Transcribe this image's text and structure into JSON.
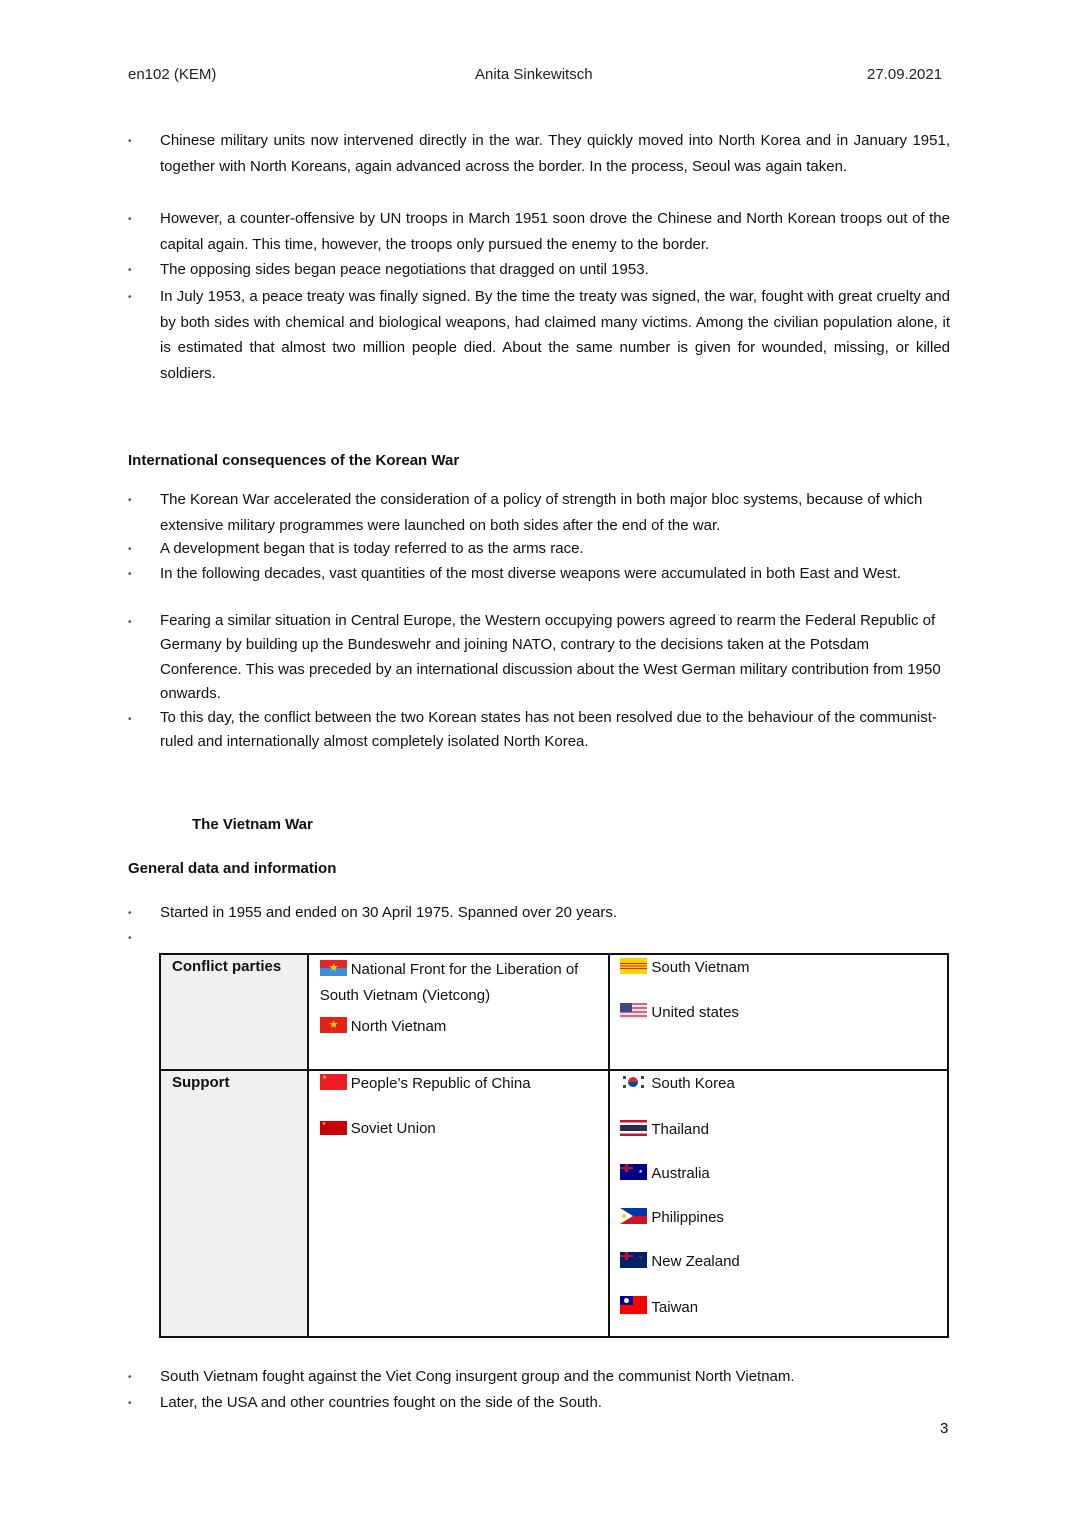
{
  "header": {
    "course": "en102 (KEM)",
    "author": "Anita Sinkewitsch",
    "date": "27.09.2021"
  },
  "korean_war_continued": {
    "bullets": [
      "Chinese military units now intervened directly in the war. They quickly moved into North Korea and in January 1951, together with North Koreans, again advanced across the border. In the process, Seoul was again taken.",
      "However, a counter-offensive by UN troops in March 1951 soon drove the Chinese and North Korean troops out of the capital again. This time, however, the troops only pursued the enemy to the border.",
      "The opposing sides began peace negotiations that dragged on until 1953.",
      "In July 1953, a peace treaty was finally signed. By the time the treaty was signed, the war, fought with great cruelty and by both sides with chemical and biological weapons, had claimed many victims. Among the civilian population alone, it is estimated that almost two million people died. About the same number is given for wounded, missing, or killed soldiers."
    ]
  },
  "international_consequences": {
    "heading": "International consequences of the Korean War",
    "bullets": [
      "The Korean War accelerated the consideration of a policy of strength in both major bloc systems, because of which extensive military programmes were launched on both sides after the end of the war.",
      "A development began that is today referred to as the arms race.",
      "In the following decades, vast quantities of the most diverse weapons were accumulated in both East and West.",
      "Fearing a similar situation in Central Europe, the Western occupying powers agreed to rearm the Federal Republic of Germany by building up the Bundeswehr and joining NATO, contrary to the decisions taken at the Potsdam Conference. This was preceded by an international discussion about the West German military contribution from 1950 onwards.",
      "To this day, the conflict between the two Korean states has not been resolved due to the behaviour of the communist-ruled and internationally almost completely isolated North Korea."
    ]
  },
  "vietnam_war": {
    "title": "The Vietnam War",
    "subheading": "General data and information",
    "bullets": [
      "Started in 1955 and ended on 30 April 1975. Spanned over 20 years.",
      ""
    ],
    "table": {
      "rows": [
        {
          "label": "Conflict parties",
          "side_a": [
            {
              "name": "National Front for the Liberation of South Vietnam (Vietcong)",
              "flag": "vietcong-flag-icon"
            },
            {
              "name": "North Vietnam",
              "flag": "north-vietnam-flag-icon"
            }
          ],
          "side_b": [
            {
              "name": "South Vietnam",
              "flag": "south-vietnam-flag-icon"
            },
            {
              "name": "United states",
              "flag": "usa-flag-icon"
            }
          ]
        },
        {
          "label": "Support",
          "side_a": [
            {
              "name": "People’s Republic of China",
              "flag": "china-flag-icon"
            },
            {
              "name": "Soviet Union",
              "flag": "soviet-union-flag-icon"
            }
          ],
          "side_b": [
            {
              "name": "South Korea",
              "flag": "south-korea-flag-icon"
            },
            {
              "name": "Thailand",
              "flag": "thailand-flag-icon"
            },
            {
              "name": "Australia",
              "flag": "australia-flag-icon"
            },
            {
              "name": "Philippines",
              "flag": "philippines-flag-icon"
            },
            {
              "name": "New Zealand",
              "flag": "new-zealand-flag-icon"
            },
            {
              "name": "Taiwan",
              "flag": "taiwan-flag-icon"
            }
          ]
        }
      ]
    },
    "after_bullets": [
      "South Vietnam fought against the Viet Cong insurgent group and the communist North Vietnam.",
      "Later, the USA and other countries fought on the side of the South."
    ]
  },
  "page_number": "3"
}
